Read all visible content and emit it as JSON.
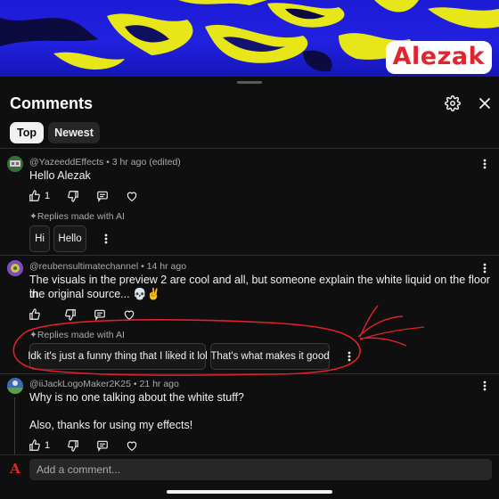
{
  "video": {
    "watermark": "Alezak"
  },
  "header": {
    "title": "Comments",
    "settings_icon": "gear-icon"
  },
  "sort_tabs": [
    {
      "label": "Top",
      "active": true
    },
    {
      "label": "Newest",
      "active": false
    }
  ],
  "comments": [
    {
      "author": "@YazeeddEffects",
      "meta": " • 3 hr ago (edited)",
      "lines": [
        "Hello Alezak"
      ],
      "like_count": "1",
      "ai_replies_label": "Replies made with AI",
      "ai_replies": [
        "Hi",
        "Hello"
      ]
    },
    {
      "author": "@reubensultimatechannel",
      "meta": " • 14 hr ago",
      "lines": [
        "The visuals in the preview 2 are cool and all, but someone explain the white liquid on the floor in",
        "the original source... 💀✌️"
      ],
      "like_count": "",
      "ai_replies_label": "Replies made with AI",
      "ai_replies": [
        "Idk it's just a funny thing that I liked it lol",
        "That's what makes it good"
      ]
    },
    {
      "author": "@iiJackLogoMaker2K25",
      "meta": " • 21 hr ago",
      "lines": [
        "Why is no one talking about the white stuff?",
        "Also, thanks for using my effects!"
      ],
      "like_count": "1"
    }
  ],
  "composer": {
    "avatar_letter": "A",
    "placeholder": "Add a comment..."
  },
  "colors": {
    "background": "#0f0f0f",
    "chip_active": "#f1f1f1",
    "annotation_red": "#e0202a",
    "watermark_red": "#e0252f",
    "video_blue": "#2121e0",
    "video_yellow": "#e6e619"
  }
}
